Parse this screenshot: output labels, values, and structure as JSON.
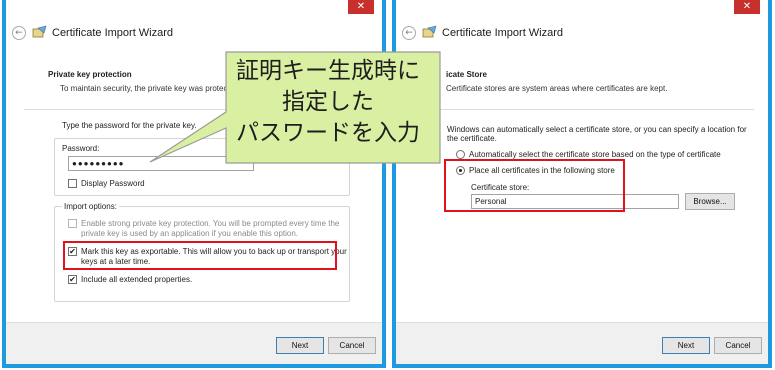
{
  "left_wizard": {
    "title": "Certificate Import Wizard",
    "close_glyph": "✕",
    "back_glyph": "←",
    "section_title": "Private key protection",
    "section_desc": "To maintain security, the private key was protect",
    "type_password_label": "Type the password for the private key.",
    "password_label": "Password:",
    "password_value": "●●●●●●●●●",
    "display_password_label": "Display Password",
    "import_options_label": "Import options:",
    "strong_protection_line1": "Enable strong private key protection. You will be prompted every time the",
    "strong_protection_line2": "private key is used by an application if you enable this option.",
    "exportable_line1": "Mark this key as exportable. This will allow you to back up or transport your",
    "exportable_line2": "keys at a later time.",
    "extended_props_label": "Include all extended properties.",
    "check_glyph": "✔",
    "next_label": "Next",
    "cancel_label": "Cancel"
  },
  "right_wizard": {
    "title": "Certificate Import Wizard",
    "close_glyph": "✕",
    "back_glyph": "←",
    "section_title": "icate Store",
    "section_desc": "Certificate stores are system areas where certificates are kept.",
    "auto_desc_line1": "Windows can automatically select a certificate store, or you can specify a location for",
    "auto_desc_line2": "the certificate.",
    "auto_select_label": "Automatically select the certificate store based on the type of certificate",
    "place_all_label": "Place all certificates in the following store",
    "store_label": "Certificate store:",
    "store_value": "Personal",
    "browse_label": "Browse...",
    "next_label": "Next",
    "cancel_label": "Cancel"
  },
  "callout": {
    "line1": "証明キー生成時に",
    "line2": "指定した",
    "line3": "パスワードを入力",
    "fill_color": "#d9f0a3",
    "border_color": "#9a9a9a"
  },
  "colors": {
    "window_border": "#1e9be0",
    "close_button": "#c7302b",
    "highlight_box": "#e0121d"
  }
}
